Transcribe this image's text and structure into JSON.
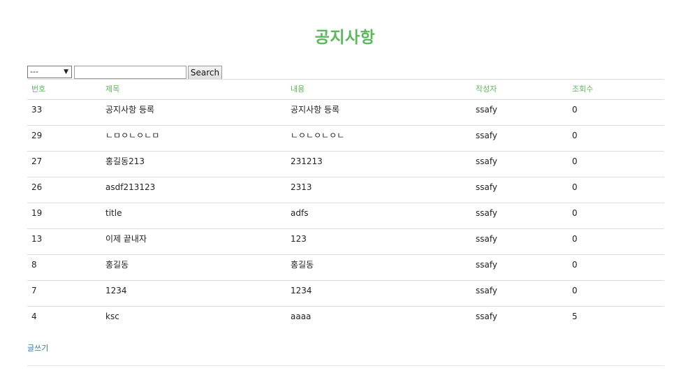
{
  "page": {
    "title": "공지사항"
  },
  "search": {
    "select_value": "---",
    "input_value": "",
    "button_label": "Search"
  },
  "table": {
    "headers": [
      "번호",
      "제목",
      "내용",
      "작성자",
      "조회수"
    ],
    "rows": [
      [
        "33",
        "공지사항 등록",
        "공지사항 등록",
        "ssafy",
        "0"
      ],
      [
        "29",
        "ㄴㅁㅇㄴㅇㄴㅁ",
        "ㄴㅇㄴㅇㄴㅇㄴ",
        "ssafy",
        "0"
      ],
      [
        "27",
        "홍길동213",
        "231213",
        "ssafy",
        "0"
      ],
      [
        "26",
        "asdf213123",
        "2313",
        "ssafy",
        "0"
      ],
      [
        "19",
        "title",
        "adfs",
        "ssafy",
        "0"
      ],
      [
        "13",
        "이제 끝내자",
        "123",
        "ssafy",
        "0"
      ],
      [
        "8",
        "홍길동",
        "홍길동",
        "ssafy",
        "0"
      ],
      [
        "7",
        "1234",
        "1234",
        "ssafy",
        "0"
      ],
      [
        "4",
        "ksc",
        "aaaa",
        "ssafy",
        "5"
      ]
    ]
  },
  "footer": {
    "write_link": "글쓰기"
  },
  "colors": {
    "accent": "#5cb85c",
    "link": "#337ab7",
    "divider": "#dddddd"
  },
  "icons": {
    "select_arrow": "triangle-down-icon"
  }
}
